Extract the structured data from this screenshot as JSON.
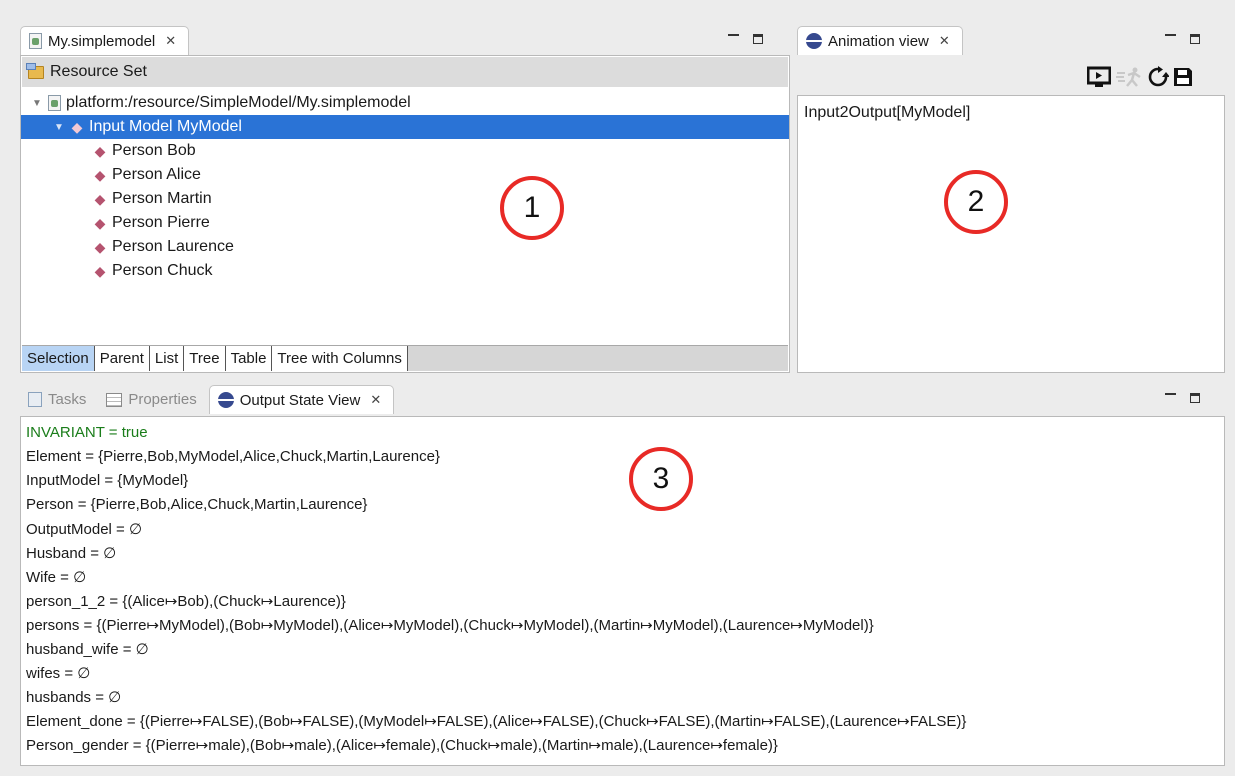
{
  "editor": {
    "tab_title": "My.simplemodel",
    "resource_set_label": "Resource Set",
    "tree": {
      "root": "platform:/resource/SimpleModel/My.simplemodel",
      "model": "Input Model MyModel",
      "persons": [
        "Person Bob",
        "Person Alice",
        "Person Martin",
        "Person Pierre",
        "Person Laurence",
        "Person Chuck"
      ]
    },
    "bottom_tabs": [
      "Selection",
      "Parent",
      "List",
      "Tree",
      "Table",
      "Tree with Columns"
    ],
    "marker": "1"
  },
  "animation": {
    "tab_title": "Animation view",
    "content": "Input2Output[MyModel]",
    "toolbar_icons": [
      "play-screen-icon",
      "run-disabled-icon",
      "refresh-icon",
      "save-icon"
    ],
    "marker": "2"
  },
  "bottom": {
    "tabs": [
      "Tasks",
      "Properties",
      "Output State View"
    ],
    "marker": "3",
    "lines": [
      "INVARIANT = true",
      "Element = {Pierre,Bob,MyModel,Alice,Chuck,Martin,Laurence}",
      "InputModel = {MyModel}",
      "Person = {Pierre,Bob,Alice,Chuck,Martin,Laurence}",
      "OutputModel = ∅",
      "Husband = ∅",
      "Wife = ∅",
      "person_1_2 = {(Alice↦Bob),(Chuck↦Laurence)}",
      "persons = {(Pierre↦MyModel),(Bob↦MyModel),(Alice↦MyModel),(Chuck↦MyModel),(Martin↦MyModel),(Laurence↦MyModel)}",
      "husband_wife = ∅",
      "wifes = ∅",
      "husbands = ∅",
      "Element_done = {(Pierre↦FALSE),(Bob↦FALSE),(MyModel↦FALSE),(Alice↦FALSE),(Chuck↦FALSE),(Martin↦FALSE),(Laurence↦FALSE)}",
      "Person_gender = {(Pierre↦male),(Bob↦male),(Alice↦female),(Chuck↦male),(Martin↦male),(Laurence↦female)}"
    ]
  },
  "colors": {
    "selection": "#2a73d6",
    "invariant": "#1a7d1a",
    "marker": "#e82a26"
  }
}
